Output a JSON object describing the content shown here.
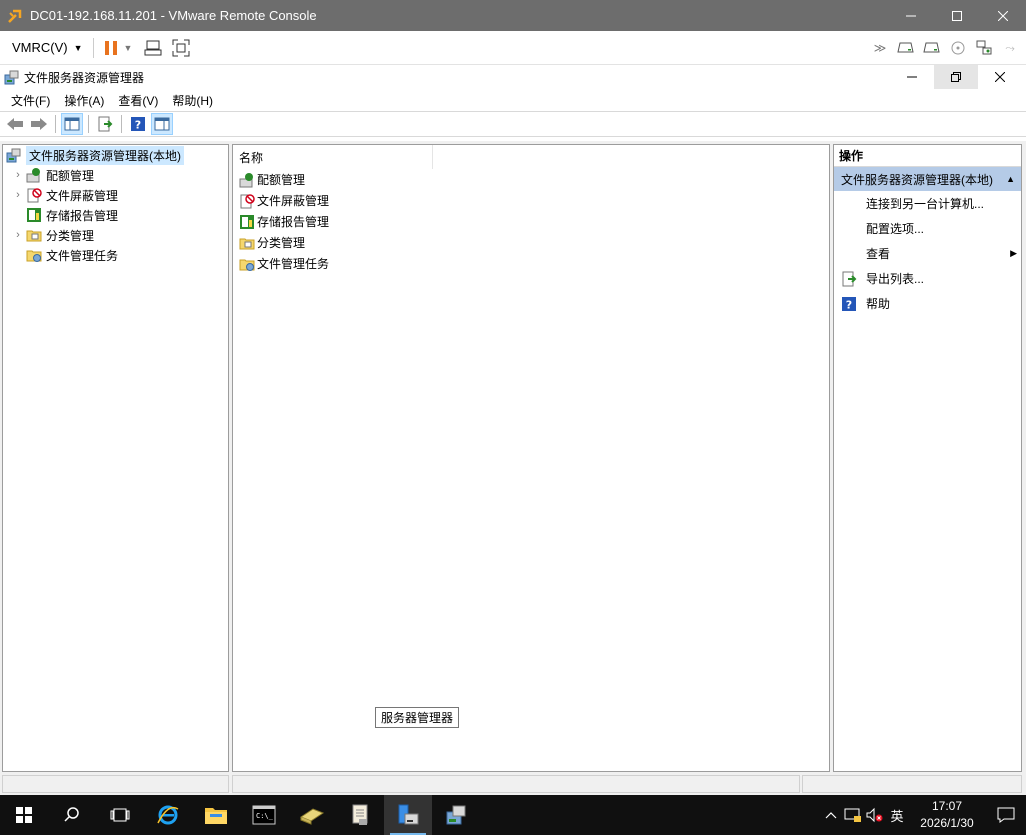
{
  "vmrc": {
    "window_title": "DC01-192.168.11.201 - VMware Remote Console",
    "menu_label": "VMRC(V)",
    "colors": {
      "titlebar": "#6d6d6d",
      "pause": "#e8731f"
    }
  },
  "mmc": {
    "window_title": "文件服务器资源管理器",
    "menu": [
      "文件(F)",
      "操作(A)",
      "查看(V)",
      "帮助(H)"
    ],
    "tree": {
      "root": "文件服务器资源管理器(本地)",
      "children": [
        {
          "label": "配额管理",
          "expandable": true,
          "icon": "quota-icon"
        },
        {
          "label": "文件屏蔽管理",
          "expandable": true,
          "icon": "file-screen-icon"
        },
        {
          "label": "存储报告管理",
          "expandable": false,
          "icon": "storage-report-icon"
        },
        {
          "label": "分类管理",
          "expandable": true,
          "icon": "classification-icon"
        },
        {
          "label": "文件管理任务",
          "expandable": false,
          "icon": "file-task-icon"
        }
      ]
    },
    "list": {
      "column_header": "名称",
      "items": [
        "配额管理",
        "文件屏蔽管理",
        "存储报告管理",
        "分类管理",
        "文件管理任务"
      ]
    },
    "actions": {
      "header": "操作",
      "section": "文件服务器资源管理器(本地)",
      "items": [
        "连接到另一台计算机...",
        "配置选项...",
        "查看",
        "导出列表...",
        "帮助"
      ]
    },
    "tooltip": "服务器管理器"
  },
  "taskbar": {
    "time": "17:07",
    "date": "2026/1/30",
    "ime": "英",
    "colors": {
      "background": "#101010",
      "accent": "#76b9ed"
    }
  }
}
